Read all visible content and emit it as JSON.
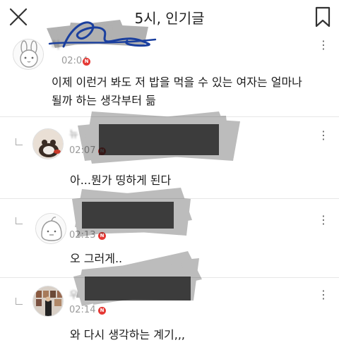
{
  "header": {
    "title": "5시, 인기글",
    "close_icon": "close-icon",
    "bookmark_icon": "bookmark-icon"
  },
  "comments": [
    {
      "author_visible": "허",
      "time": "02:04",
      "badge": "N",
      "text_line1": "이제 이런거 봐도 저 밥을 먹을 수 있는 여자는 얼마나",
      "text_line2": "될까 하는 생각부터 듦",
      "is_reply": false
    },
    {
      "author_visible": "뉴",
      "time": "02:07",
      "badge": "N",
      "text_line1": "아...뭔가 띵하게 된다",
      "is_reply": true
    },
    {
      "author_visible": "",
      "time": "02:13",
      "badge": "N",
      "text_line1": "오 그러게..",
      "is_reply": true
    },
    {
      "author_visible": "우",
      "time": "02:14",
      "badge": "N",
      "text_line1": "와 다시 생각하는 계기,,,",
      "is_reply": true
    }
  ],
  "more_icon": "more-vertical-icon"
}
